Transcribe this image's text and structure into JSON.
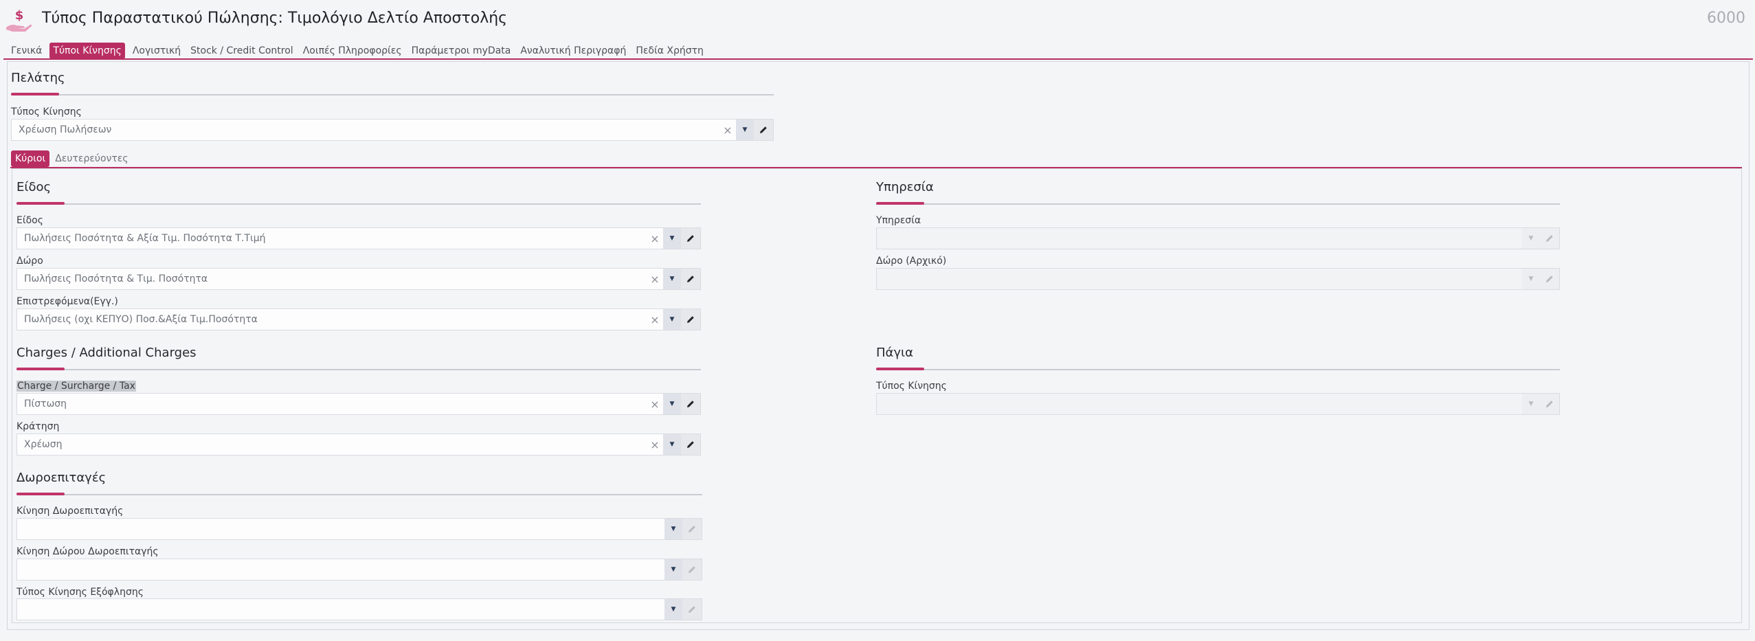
{
  "header": {
    "title": "Τύπος Παραστατικού Πώλησης: Τιμολόγιο Δελτίο Αποστολής",
    "code": "6000",
    "icon": "hand-dollar-icon"
  },
  "top_tabs": [
    {
      "label": "Γενικά",
      "active": false
    },
    {
      "label": "Τύποι Κίνησης",
      "active": true
    },
    {
      "label": "Λογιστική",
      "active": false
    },
    {
      "label": "Stock / Credit Control",
      "active": false
    },
    {
      "label": "Λοιπές Πληροφορίες",
      "active": false
    },
    {
      "label": "Παράμετροι myData",
      "active": false
    },
    {
      "label": "Αναλυτική Περιγραφή",
      "active": false
    },
    {
      "label": "Πεδία Χρήστη",
      "active": false
    }
  ],
  "customer": {
    "title": "Πελάτης",
    "movement_type": {
      "label": "Τύπος Κίνησης",
      "value": "Χρέωση Πωλήσεων"
    }
  },
  "inner_tabs": [
    {
      "label": "Κύριοι",
      "active": true
    },
    {
      "label": "Δευτερεύοντες",
      "active": false
    }
  ],
  "item": {
    "title": "Είδος",
    "fields": [
      {
        "label": "Είδος",
        "value": "Πωλήσεις Ποσότητα & Αξία Τιμ. Ποσότητα Τ.Τιμή"
      },
      {
        "label": "Δώρο",
        "value": "Πωλήσεις Ποσότητα & Τιμ. Ποσότητα"
      },
      {
        "label": "Επιστρεφόμενα(Εγγ.)",
        "value": "Πωλήσεις (οχι ΚΕΠΥΟ) Ποσ.&Αξία Τιμ.Ποσότητα"
      }
    ]
  },
  "service": {
    "title": "Υπηρεσία",
    "fields": [
      {
        "label": "Υπηρεσία",
        "value": ""
      },
      {
        "label": "Δώρο (Αρχικό)",
        "value": ""
      }
    ]
  },
  "charges": {
    "title": "Charges / Additional Charges",
    "fields": [
      {
        "label": "Charge / Surcharge / Tax",
        "value": "Πίστωση"
      },
      {
        "label": "Κράτηση",
        "value": "Χρέωση"
      }
    ]
  },
  "fixed_assets": {
    "title": "Πάγια",
    "fields": [
      {
        "label": "Τύπος Κίνησης",
        "value": ""
      }
    ]
  },
  "gift_vouchers": {
    "title": "Δωροεπιταγές",
    "fields": [
      {
        "label": "Κίνηση Δωροεπιταγής",
        "value": ""
      },
      {
        "label": "Κίνηση Δώρου Δωροεπιταγής",
        "value": ""
      },
      {
        "label": "Τύπος Κίνησης Εξόφλησης",
        "value": ""
      }
    ]
  },
  "colors": {
    "accent": "#b82e62",
    "background": "#f4f5f7"
  }
}
